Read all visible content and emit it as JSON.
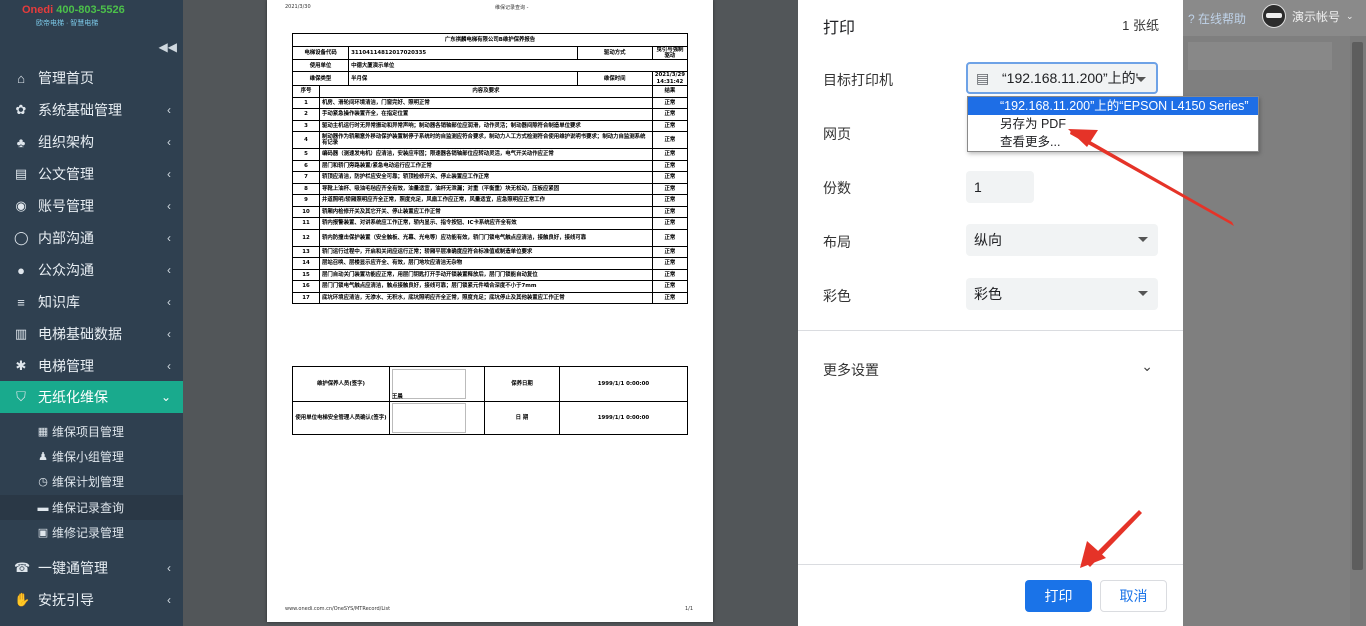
{
  "app": {
    "logo_main": "Onedi",
    "logo_phone": "400-803-5526",
    "logo_sub": "欧帝电梯 · 智慧电梯",
    "help": "在线帮助",
    "user": "演示帐号"
  },
  "sidebar": {
    "items": [
      {
        "label": "管理首页",
        "icon": "home-icon",
        "glyph": "⌂"
      },
      {
        "label": "系统基础管理",
        "icon": "gear-icon",
        "glyph": "✿"
      },
      {
        "label": "组织架构",
        "icon": "sitemap-icon",
        "glyph": "♣"
      },
      {
        "label": "公文管理",
        "icon": "document-icon",
        "glyph": "▤"
      },
      {
        "label": "账号管理",
        "icon": "user-icon",
        "glyph": "◉"
      },
      {
        "label": "内部沟通",
        "icon": "chat-bubble-icon",
        "glyph": "◯"
      },
      {
        "label": "公众沟通",
        "icon": "comments-icon",
        "glyph": "●"
      },
      {
        "label": "知识库",
        "icon": "server-icon",
        "glyph": "≡"
      },
      {
        "label": "电梯基础数据",
        "icon": "bar-chart-icon",
        "glyph": "▥"
      },
      {
        "label": "电梯管理",
        "icon": "asterisk-icon",
        "glyph": "✱"
      },
      {
        "label": "无纸化维保",
        "icon": "shield-icon",
        "glyph": "⛉"
      }
    ],
    "sub_items": [
      {
        "label": "维保项目管理",
        "icon": "table-icon",
        "glyph": "▦"
      },
      {
        "label": "维保小组管理",
        "icon": "users-icon",
        "glyph": "♟"
      },
      {
        "label": "维保计划管理",
        "icon": "clock-icon",
        "glyph": "◷"
      },
      {
        "label": "维保记录查询",
        "icon": "list-icon",
        "glyph": "▬"
      },
      {
        "label": "维修记录管理",
        "icon": "camera-icon",
        "glyph": "▣"
      }
    ],
    "bottom_items": [
      {
        "label": "一键通管理",
        "icon": "phone-icon",
        "glyph": "☎"
      },
      {
        "label": "安抚引导",
        "icon": "hand-icon",
        "glyph": "✋"
      }
    ]
  },
  "paper": {
    "date": "2021/3/30",
    "page_title": "维保记录查询 -",
    "url": "www.onedi.com.cn/OneSYS/MTRecord/List",
    "page_no": "1/1",
    "report_title": "广东祺麟电梯有限公司B维护保养报告",
    "info": {
      "code_label": "电梯设备代码",
      "code": "31104114812017020335",
      "drive_label": "驱动方式",
      "drive": "曳引与强制驱动",
      "unit_label": "使用单位",
      "unit": "中德大厦演示单位",
      "type_label": "维保类型",
      "type": "半月保",
      "time_label": "维保时间",
      "time": "2021/3/29 14:31:42"
    },
    "col_no": "序号",
    "col_content": "内容及要求",
    "col_result": "结果",
    "rows": [
      {
        "n": "1",
        "text": "机房、滑轮间环境清洁，门窗完好、照明正常",
        "r": "正常"
      },
      {
        "n": "2",
        "text": "手动紧急操作装置齐全，在指定位置",
        "r": "正常"
      },
      {
        "n": "3",
        "text": "驱动主机运行时无异常振动和异常声响；制动器各销轴部位应润滑，动作灵活；制动器间隙符合制造单位要求",
        "r": "正常"
      },
      {
        "n": "4",
        "text": "制动器作为轿厢意外移动保护装置制停子系统时的自监测应符合要求，制动力人工方式检测符合使用维护说明书要求；制动力自监测系统有记录",
        "r": "正常"
      },
      {
        "n": "5",
        "text": "编码器（测速发电机）应清洁，安装应牢固；限速器各销轴部位应转动灵活，电气开关动作应正常",
        "r": "正常"
      },
      {
        "n": "6",
        "text": "层门和轿门旁路装置/紧急电动运行应工作正常",
        "r": "正常"
      },
      {
        "n": "7",
        "text": "轿顶应清洁，防护栏应安全可靠；轿顶检修开关、停止装置应工作正常",
        "r": "正常"
      },
      {
        "n": "8",
        "text": "导靴上油杯、吸油毛毡应齐全有效，油量适宜，油杯无泄漏；对重（平衡重）块无松动，压板应紧固",
        "r": "正常"
      },
      {
        "n": "9",
        "text": "井道照明/轿厢照明应齐全正常，照度充足，风扇工作应正常，风量适宜，应急照明应正常工作",
        "r": "正常"
      },
      {
        "n": "10",
        "text": "轿厢内检修开关及其它开关、停止装置应工作正常",
        "r": "正常"
      },
      {
        "n": "11",
        "text": "轿内报警装置、对讲系统应工作正常，轿内显示、指令按钮、IC卡系统应齐全有效",
        "r": "正常"
      },
      {
        "n": "12",
        "text": "轿内防撞击保护装置（安全触板、光幕、光电等）应功能有效，轿门门锁电气触点应清洁，接触良好，接线可靠",
        "r": "正常"
      },
      {
        "n": "13",
        "text": "轿门运行过程中，开启和关闭应运行正常；轿厢平层准确度应符合标准值或制造单位要求",
        "r": "正常"
      },
      {
        "n": "14",
        "text": "层站召唤、层楼显示应齐全、有效，层门地坎应清洁无杂物",
        "r": "正常"
      },
      {
        "n": "15",
        "text": "层门自动关门装置功能应正常，用层门钥匙打开手动开锁装置释放后，层门门锁能自动复位",
        "r": "正常"
      },
      {
        "n": "16",
        "text": "层门门锁电气触点应清洁，触点接触良好，接线可靠；层门锁紧元件啮合深度不小于7mm",
        "r": "正常"
      },
      {
        "n": "17",
        "text": "底坑环境应清洁，无渗水、无积水，底坑照明应齐全正常，照度充足；底坑停止及其他装置应工作正常",
        "r": "正常"
      }
    ],
    "sign1_label": "维护保养人员(签字)",
    "sign1_name": "王晨",
    "date1_label": "保养日期",
    "date1": "1999/1/1 0:00:00",
    "sign2_label": "使用单位电梯安全管理人员确认(签字)",
    "date2_label": "日 期",
    "date2": "1999/1/1 0:00:00"
  },
  "dialog": {
    "title": "打印",
    "sheets": "1 张纸",
    "printer_label": "目标打印机",
    "printer_value": "“192.168.11.200”上的'",
    "pages_label": "网页",
    "copies_label": "份数",
    "copies_value": "1",
    "layout_label": "布局",
    "layout_value": "纵向",
    "color_label": "彩色",
    "color_value": "彩色",
    "more_settings": "更多设置",
    "print_button": "打印",
    "cancel_button": "取消",
    "dropdown_options": [
      "“192.168.11.200”上的“EPSON L4150 Series”",
      "另存为 PDF",
      "查看更多..."
    ]
  },
  "colors": {
    "sidebar_bg": "#2f4050",
    "sidebar_active": "#19aa8d",
    "primary_button": "#1a73e8",
    "annotation_arrow": "#e53328"
  }
}
